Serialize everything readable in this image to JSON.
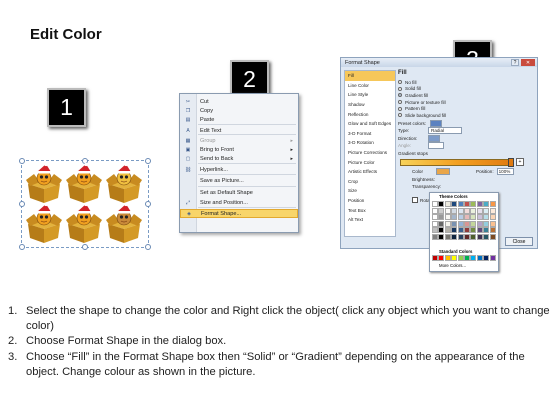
{
  "title": "Edit Color",
  "steps": {
    "one": "1",
    "two": "2",
    "three": "3"
  },
  "context_menu": {
    "items": [
      {
        "label": "Cut",
        "icon": "scissors-icon"
      },
      {
        "label": "Copy",
        "icon": "copy-icon"
      },
      {
        "label": "Paste",
        "icon": "paste-icon"
      },
      {
        "label": "Edit Text",
        "icon": "edit-text-icon"
      },
      {
        "label": "Group",
        "icon": "group-icon",
        "disabled": true
      },
      {
        "label": "Bring to Front",
        "icon": "bring-front-icon"
      },
      {
        "label": "Send to Back",
        "icon": "send-back-icon"
      },
      {
        "label": "Hyperlink...",
        "icon": "hyperlink-icon"
      },
      {
        "label": "Save as Picture...",
        "icon": ""
      },
      {
        "label": "Set as Default Shape",
        "icon": ""
      },
      {
        "label": "Size and Position...",
        "icon": "size-icon"
      },
      {
        "label": "Format Shape...",
        "icon": "format-shape-icon",
        "highlighted": true
      }
    ]
  },
  "dialog": {
    "title": "Format Shape",
    "categories": [
      "Fill",
      "Line Color",
      "Line Style",
      "Shadow",
      "Reflection",
      "Glow and Soft Edges",
      "3-D Format",
      "3-D Rotation",
      "Picture Corrections",
      "Picture Color",
      "Artistic Effects",
      "Crop",
      "Size",
      "Position",
      "Text Box",
      "Alt Text"
    ],
    "selected_category": "Fill",
    "section": "Fill",
    "fill_options": [
      "No fill",
      "Solid fill",
      "Gradient fill",
      "Picture or texture fill",
      "Pattern fill",
      "Slide background fill"
    ],
    "selected_fill": "Gradient fill",
    "preset_colors": "Preset colors:",
    "type_label": "Type:",
    "type_value": "Radial",
    "direction_label": "Direction:",
    "angle_label": "Angle:",
    "gradient_stops": "Gradient stops",
    "color_label": "Color",
    "position_label": "Position:",
    "position_value": "100%",
    "brightness_label": "Brightness:",
    "transparency_label": "Transparency:",
    "rotate_label": "Rotate w",
    "close": "Close",
    "theme_colors": "Theme Colors",
    "standard_colors": "Standard Colors",
    "more_colors": "More Colors..."
  },
  "instructions": [
    {
      "num": "1.",
      "text": "Select the shape to change the color and Right click the object( click any object which you want to change color)"
    },
    {
      "num": "2.",
      "text": "Choose Format Shape in the dialog box."
    },
    {
      "num": "3.",
      "text": "Choose “Fill” in the Format Shape box then “Solid” or “Gradient” depending on the appearance of the object. Change colour as shown in the picture."
    }
  ]
}
